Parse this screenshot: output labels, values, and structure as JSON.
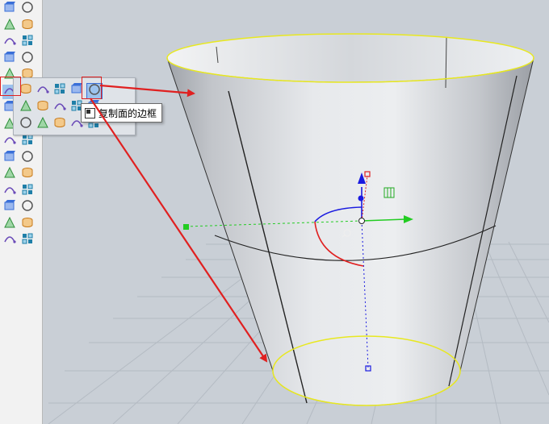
{
  "colors": {
    "viewport_bg": "#c9cfd6",
    "grid_line": "#b5bcc4",
    "surface_light": "#e6e8ec",
    "surface_dark": "#9ea2a8",
    "selection_yellow": "#e8e820",
    "annotation_red": "#e02020",
    "gizmo_blue": "#1a1ae0",
    "gizmo_green": "#22cc22",
    "gizmo_red": "#e02020"
  },
  "toolbar": {
    "buttons": [
      {
        "icon": "point-icon"
      },
      {
        "icon": "circle-icon"
      },
      {
        "icon": "polyline-icon"
      },
      {
        "icon": "rectangle-icon"
      },
      {
        "icon": "arc-icon"
      },
      {
        "icon": "curve-icon"
      },
      {
        "icon": "transform-icon"
      },
      {
        "icon": "surface-icon"
      },
      {
        "icon": "solid-box-icon"
      },
      {
        "icon": "mesh-icon"
      },
      {
        "icon": "surface-edge-tools-icon",
        "active": true
      },
      {
        "icon": "analyze-icon"
      },
      {
        "icon": "gumball-icon"
      },
      {
        "icon": "join-icon"
      },
      {
        "icon": "boolean-icon"
      },
      {
        "icon": "snap-icon"
      },
      {
        "icon": "rotate-icon"
      },
      {
        "icon": "fillet-icon"
      },
      {
        "icon": "text-icon"
      },
      {
        "icon": "dimension-icon"
      },
      {
        "icon": "block-icon"
      },
      {
        "icon": "group-icon"
      },
      {
        "icon": "solid-tools-icon"
      },
      {
        "icon": "render-icon"
      },
      {
        "icon": "array-icon"
      },
      {
        "icon": "layer-icon"
      },
      {
        "icon": "properties-icon"
      },
      {
        "icon": "check-icon"
      },
      {
        "icon": "material-icon"
      },
      {
        "icon": "light-icon"
      }
    ]
  },
  "flyout": {
    "buttons": [
      {
        "icon": "cylinder-icon"
      },
      {
        "icon": "truncated-cone-icon"
      },
      {
        "icon": "planar-surface-icon"
      },
      {
        "icon": "plane-icon"
      },
      {
        "icon": "duplicate-face-border-icon",
        "active": true
      },
      {
        "icon": "edge-surface-icon"
      },
      {
        "icon": "patch-icon"
      },
      {
        "icon": "offset-surface-icon"
      },
      {
        "icon": "extrude-surface-icon"
      },
      {
        "icon": "blend-surface-icon"
      },
      {
        "icon": "loft-icon"
      },
      {
        "icon": "network-surface-icon"
      },
      {
        "icon": "point-cloud-icon"
      },
      {
        "icon": "drape-icon"
      },
      {
        "icon": "box-edit-icon"
      }
    ]
  },
  "tooltip": {
    "icon": "duplicate-face-border-icon",
    "text": "复制面的边框"
  },
  "gizmo": {
    "scale_handle_icon": "scale-handle-icon",
    "rotate_handle_icon": "rotate-handle-icon"
  }
}
